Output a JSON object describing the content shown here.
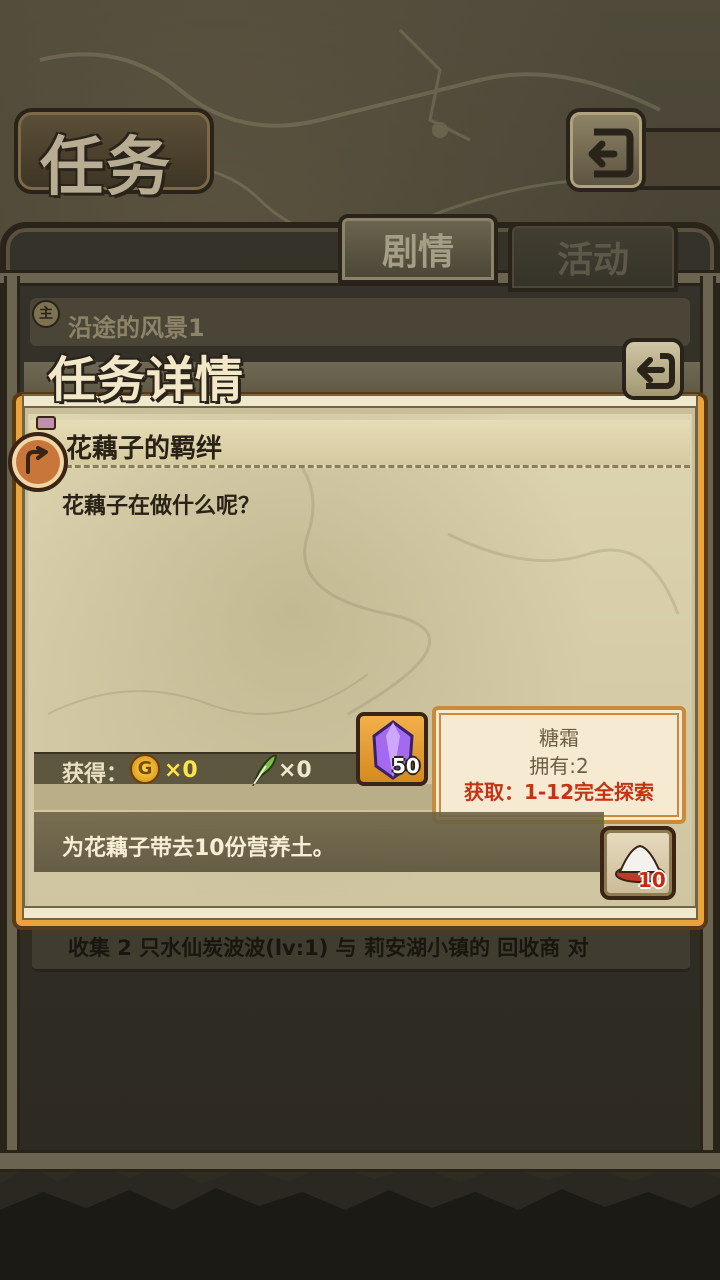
{
  "screen": {
    "title": "任务",
    "tabs": [
      {
        "label": "剧情",
        "active": true
      },
      {
        "label": "活动",
        "active": false
      }
    ]
  },
  "quest_list": {
    "badge": "主",
    "item_name": "沿途的风景1",
    "item_description": "收集 2 只水仙炭波波(lv:1) 与 莉安湖小镇的 回收商 对"
  },
  "detail": {
    "title": "任务详情",
    "subquest_name": "花藕子的羁绊",
    "subquest_text": "花藕子在做什么呢？",
    "reward_label": "获得：",
    "rewards": {
      "coin_symbol": "G",
      "coin_amount": "×0",
      "feather_amount": "×0",
      "crystal_count": "50"
    },
    "objective": "为花藕子带去10份营养土。",
    "required_item_count": "10"
  },
  "tooltip": {
    "name": "糖霜",
    "owned": "拥有:2",
    "source": "获取：1-12完全探索"
  },
  "colors": {
    "panel_orange": "#e9a53c",
    "coin_text": "#ffe34a",
    "source_red": "#c63214"
  }
}
